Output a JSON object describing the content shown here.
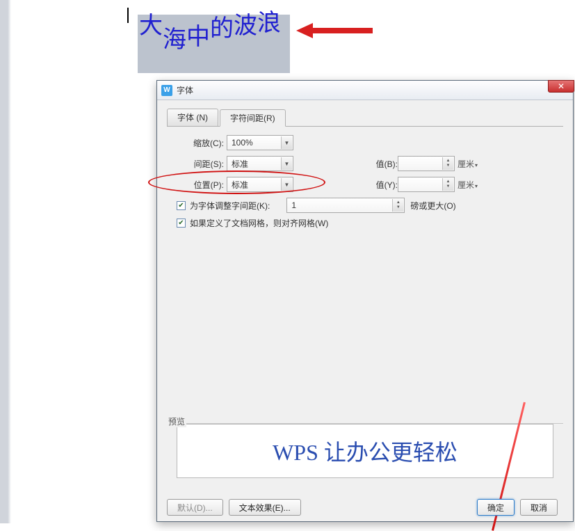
{
  "sample": {
    "chars": [
      "大",
      "海",
      "中",
      "的",
      "波",
      "浪"
    ]
  },
  "dialog": {
    "title": "字体",
    "tabs": {
      "font": "字体 (N)",
      "spacing": "字符间距(R)"
    },
    "scale": {
      "label": "缩放(C):",
      "value": "100%"
    },
    "spacingRow": {
      "label": "间距(S):",
      "value": "标准",
      "valLabel": "值(B):",
      "valField": "",
      "unit": "厘米"
    },
    "position": {
      "label": "位置(P):",
      "value": "标准",
      "valLabel": "值(Y):",
      "valField": "",
      "unit": "厘米"
    },
    "kern": {
      "checked": true,
      "label": "为字体调整字间距(K):",
      "value": "1",
      "unit": "磅或更大(O)"
    },
    "grid": {
      "checked": true,
      "label": "如果定义了文档网格，则对齐网格(W)"
    },
    "preview": {
      "legend": "预览",
      "text": "WPS 让办公更轻松"
    },
    "footer": {
      "default": "默认(D)...",
      "textEffect": "文本效果(E)...",
      "ok": "确定",
      "cancel": "取消"
    }
  }
}
